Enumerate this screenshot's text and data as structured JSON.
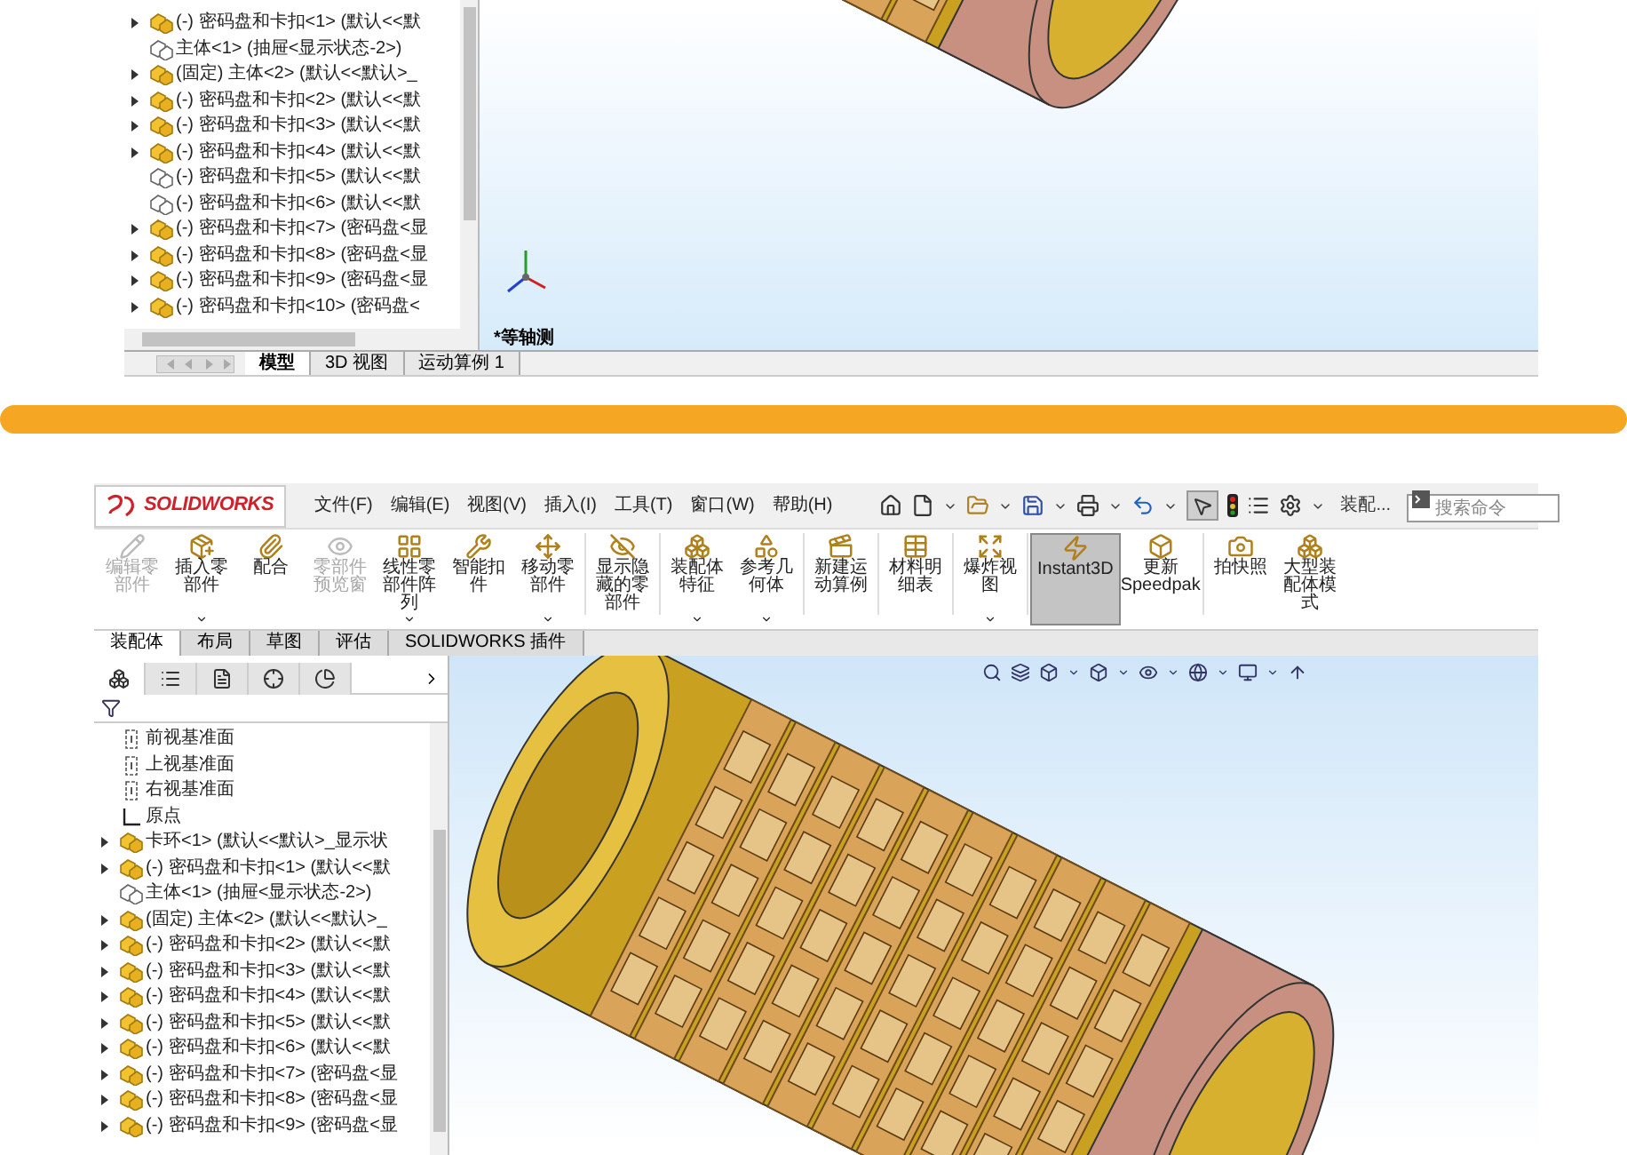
{
  "top_view": {
    "tree": {
      "items": [
        {
          "label": "(-) 密码盘和卡扣<1> (默认<<默",
          "kind": "assembly",
          "expandable": true
        },
        {
          "label": "主体<1> (抽屉<显示状态-2>)",
          "kind": "part_outline",
          "expandable": false
        },
        {
          "label": "(固定) 主体<2> (默认<<默认>_",
          "kind": "assembly",
          "expandable": true
        },
        {
          "label": "(-) 密码盘和卡扣<2> (默认<<默",
          "kind": "assembly",
          "expandable": true
        },
        {
          "label": "(-) 密码盘和卡扣<3> (默认<<默",
          "kind": "assembly",
          "expandable": true
        },
        {
          "label": "(-) 密码盘和卡扣<4> (默认<<默",
          "kind": "assembly",
          "expandable": true
        },
        {
          "label": "(-) 密码盘和卡扣<5> (默认<<默",
          "kind": "part_outline",
          "expandable": false
        },
        {
          "label": "(-) 密码盘和卡扣<6> (默认<<默",
          "kind": "part_outline",
          "expandable": false
        },
        {
          "label": "(-) 密码盘和卡扣<7> (密码盘<显",
          "kind": "assembly",
          "expandable": true
        },
        {
          "label": "(-) 密码盘和卡扣<8> (密码盘<显",
          "kind": "assembly",
          "expandable": true
        },
        {
          "label": "(-) 密码盘和卡扣<9> (密码盘<显",
          "kind": "assembly",
          "expandable": true
        },
        {
          "label": "(-) 密码盘和卡扣<10> (密码盘<",
          "kind": "assembly",
          "expandable": true
        }
      ]
    },
    "view_label": "*等轴测",
    "tabs": [
      {
        "label": "模型",
        "selected": true
      },
      {
        "label": "3D 视图",
        "selected": false
      },
      {
        "label": "运动算例 1",
        "selected": false
      }
    ]
  },
  "bottom_view": {
    "app_logo": "SOLIDWORKS",
    "menu": [
      "文件(F)",
      "编辑(E)",
      "视图(V)",
      "插入(I)",
      "工具(T)",
      "窗口(W)",
      "帮助(H)"
    ],
    "assembly_label": "装配...",
    "search": {
      "placeholder": "搜索命令"
    },
    "ribbon": [
      {
        "label": "编辑零部件",
        "disabled": true,
        "selected": false,
        "dropdown": false
      },
      {
        "label": "插入零部件",
        "disabled": false,
        "selected": false,
        "dropdown": true
      },
      {
        "label": "配合",
        "disabled": false,
        "selected": false,
        "dropdown": false
      },
      {
        "label": "零部件预览窗",
        "disabled": true,
        "selected": false,
        "dropdown": false
      },
      {
        "label": "线性零部件阵列",
        "disabled": false,
        "selected": false,
        "dropdown": true
      },
      {
        "label": "智能扣件",
        "disabled": false,
        "selected": false,
        "dropdown": false
      },
      {
        "label": "移动零部件",
        "disabled": false,
        "selected": false,
        "dropdown": true
      },
      {
        "label": "显示隐藏的零部件",
        "disabled": false,
        "selected": false,
        "dropdown": false
      },
      {
        "label": "装配体特征",
        "disabled": false,
        "selected": false,
        "dropdown": true
      },
      {
        "label": "参考几何体",
        "disabled": false,
        "selected": false,
        "dropdown": true
      },
      {
        "label": "新建运动算例",
        "disabled": false,
        "selected": false,
        "dropdown": false
      },
      {
        "label": "材料明细表",
        "disabled": false,
        "selected": false,
        "dropdown": false
      },
      {
        "label": "爆炸视图",
        "disabled": false,
        "selected": false,
        "dropdown": true
      },
      {
        "label": "Instant3D",
        "disabled": false,
        "selected": true,
        "dropdown": false
      },
      {
        "label": "更新 Speedpak",
        "disabled": false,
        "selected": false,
        "dropdown": false
      },
      {
        "label": "拍快照",
        "disabled": false,
        "selected": false,
        "dropdown": false
      },
      {
        "label": "大型装配体模式",
        "disabled": false,
        "selected": false,
        "dropdown": false
      }
    ],
    "ribbon_tabs": [
      {
        "label": "装配体",
        "selected": true
      },
      {
        "label": "布局",
        "selected": false
      },
      {
        "label": "草图",
        "selected": false
      },
      {
        "label": "评估",
        "selected": false
      },
      {
        "label": "SOLIDWORKS 插件",
        "selected": false
      }
    ],
    "panel_tabs": [
      {
        "selected": true
      },
      {
        "selected": false
      },
      {
        "selected": false
      },
      {
        "selected": false
      },
      {
        "selected": false
      }
    ],
    "tree": {
      "items": [
        {
          "label": "前视基准面",
          "kind": "plane",
          "expandable": false
        },
        {
          "label": "上视基准面",
          "kind": "plane",
          "expandable": false
        },
        {
          "label": "右视基准面",
          "kind": "plane",
          "expandable": false
        },
        {
          "label": "原点",
          "kind": "origin",
          "expandable": false
        },
        {
          "label": "卡环<1> (默认<<默认>_显示状",
          "kind": "assembly",
          "expandable": true
        },
        {
          "label": "(-) 密码盘和卡扣<1> (默认<<默",
          "kind": "assembly",
          "expandable": true
        },
        {
          "label": "主体<1> (抽屉<显示状态-2>)",
          "kind": "part_outline",
          "expandable": false
        },
        {
          "label": "(固定) 主体<2> (默认<<默认>_",
          "kind": "assembly",
          "expandable": true
        },
        {
          "label": "(-) 密码盘和卡扣<2> (默认<<默",
          "kind": "assembly",
          "expandable": true
        },
        {
          "label": "(-) 密码盘和卡扣<3> (默认<<默",
          "kind": "assembly",
          "expandable": true
        },
        {
          "label": "(-) 密码盘和卡扣<4> (默认<<默",
          "kind": "assembly",
          "expandable": true
        },
        {
          "label": "(-) 密码盘和卡扣<5> (默认<<默",
          "kind": "assembly",
          "expandable": true
        },
        {
          "label": "(-) 密码盘和卡扣<6> (默认<<默",
          "kind": "assembly",
          "expandable": true
        },
        {
          "label": "(-) 密码盘和卡扣<7> (密码盘<显",
          "kind": "assembly",
          "expandable": true
        },
        {
          "label": "(-) 密码盘和卡扣<8> (密码盘<显",
          "kind": "assembly",
          "expandable": true
        },
        {
          "label": "(-) 密码盘和卡扣<9> (密码盘<显",
          "kind": "assembly",
          "expandable": true
        }
      ]
    }
  }
}
